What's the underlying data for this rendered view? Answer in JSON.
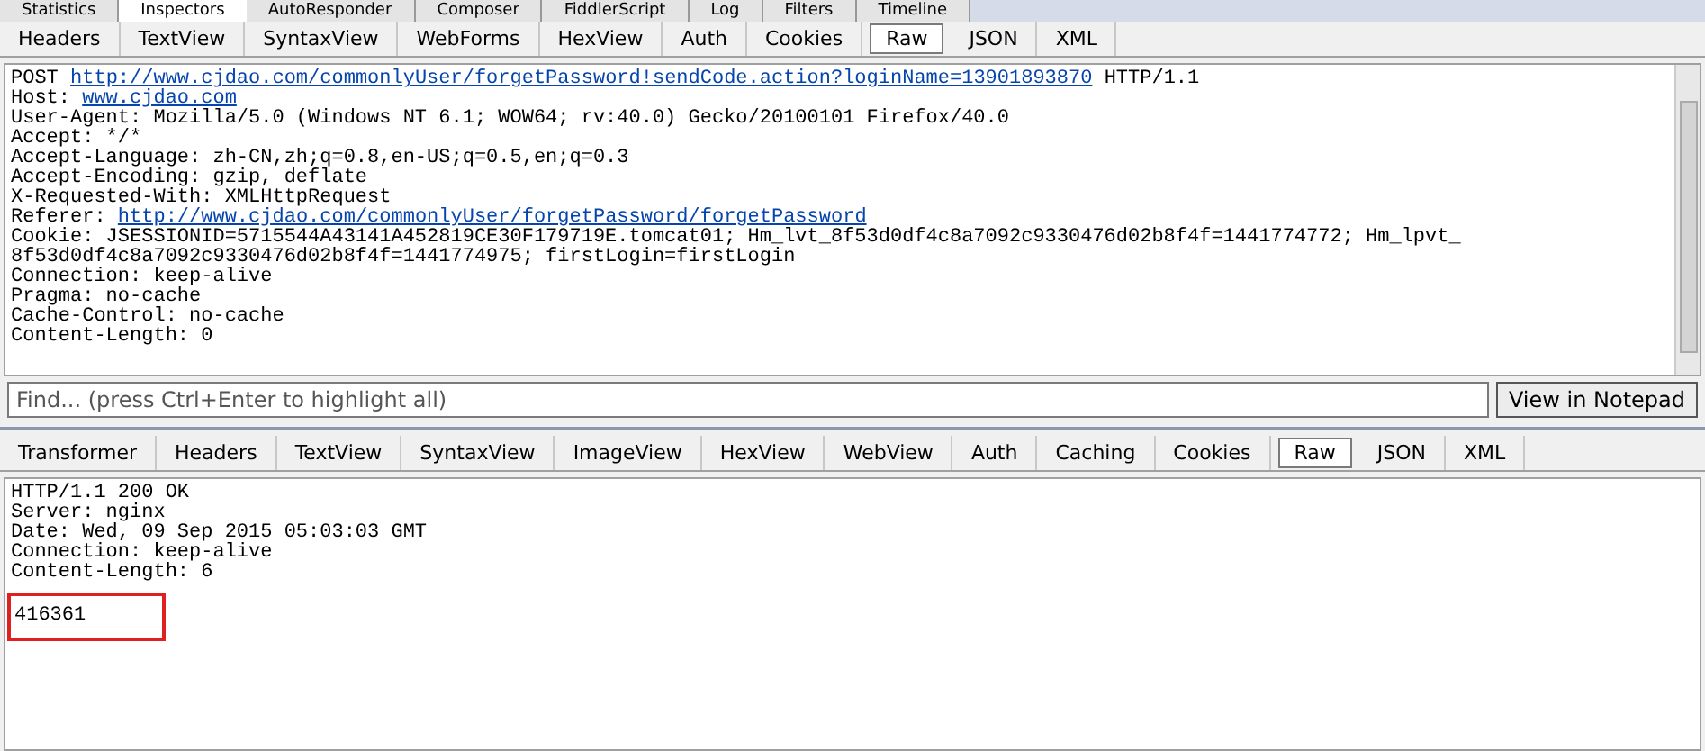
{
  "main_tabs": [
    {
      "label": "Statistics",
      "selected": false
    },
    {
      "label": "Inspectors",
      "selected": true
    },
    {
      "label": "AutoResponder",
      "selected": false
    },
    {
      "label": "Composer",
      "selected": false
    },
    {
      "label": "FiddlerScript",
      "selected": false
    },
    {
      "label": "Log",
      "selected": false
    },
    {
      "label": "Filters",
      "selected": false
    },
    {
      "label": "Timeline",
      "selected": false
    }
  ],
  "request": {
    "tabs": [
      {
        "label": "Headers",
        "selected": false
      },
      {
        "label": "TextView",
        "selected": false
      },
      {
        "label": "SyntaxView",
        "selected": false
      },
      {
        "label": "WebForms",
        "selected": false
      },
      {
        "label": "HexView",
        "selected": false
      },
      {
        "label": "Auth",
        "selected": false
      },
      {
        "label": "Cookies",
        "selected": false
      },
      {
        "label": "Raw",
        "selected": true
      },
      {
        "label": "JSON",
        "selected": false
      },
      {
        "label": "XML",
        "selected": false
      }
    ],
    "lines": [
      {
        "prefix": "POST ",
        "link": "http://www.cjdao.com/commonlyUser/forgetPassword!sendCode.action?loginName=13901893870",
        "suffix": " HTTP/1.1"
      },
      {
        "prefix": "Host: ",
        "link": "www.cjdao.com"
      },
      {
        "prefix": "User-Agent: Mozilla/5.0 (Windows NT 6.1; WOW64; rv:40.0) Gecko/20100101 Firefox/40.0"
      },
      {
        "prefix": "Accept: */*"
      },
      {
        "prefix": "Accept-Language: zh-CN,zh;q=0.8,en-US;q=0.5,en;q=0.3"
      },
      {
        "prefix": "Accept-Encoding: gzip, deflate"
      },
      {
        "prefix": "X-Requested-With: XMLHttpRequest"
      },
      {
        "prefix": "Referer: ",
        "link": "http://www.cjdao.com/commonlyUser/forgetPassword/forgetPassword"
      },
      {
        "prefix": "Cookie: JSESSIONID=5715544A43141A452819CE30F179719E.tomcat01; Hm_lvt_8f53d0df4c8a7092c9330476d02b8f4f=1441774772; Hm_lpvt_"
      },
      {
        "prefix": "8f53d0df4c8a7092c9330476d02b8f4f=1441774975; firstLogin=firstLogin"
      },
      {
        "prefix": "Connection: keep-alive"
      },
      {
        "prefix": "Pragma: no-cache"
      },
      {
        "prefix": "Cache-Control: no-cache"
      },
      {
        "prefix": "Content-Length: 0"
      }
    ],
    "find": {
      "placeholder": "Find... (press Ctrl+Enter to highlight all)"
    },
    "notepad_button": "View in Notepad"
  },
  "response": {
    "tabs": [
      {
        "label": "Transformer",
        "selected": false
      },
      {
        "label": "Headers",
        "selected": false
      },
      {
        "label": "TextView",
        "selected": false
      },
      {
        "label": "SyntaxView",
        "selected": false
      },
      {
        "label": "ImageView",
        "selected": false
      },
      {
        "label": "HexView",
        "selected": false
      },
      {
        "label": "WebView",
        "selected": false
      },
      {
        "label": "Auth",
        "selected": false
      },
      {
        "label": "Caching",
        "selected": false
      },
      {
        "label": "Cookies",
        "selected": false
      },
      {
        "label": "Raw",
        "selected": true
      },
      {
        "label": "JSON",
        "selected": false
      },
      {
        "label": "XML",
        "selected": false
      }
    ],
    "lines": [
      {
        "text": "HTTP/1.1 200 OK",
        "highlighted": false
      },
      {
        "text": "Server: nginx",
        "highlighted": false
      },
      {
        "text": "Date: Wed, 09 Sep 2015 05:03:03 GMT",
        "highlighted": false
      },
      {
        "text": "Connection: keep-alive",
        "highlighted": false
      },
      {
        "text": "Content-Length: 6",
        "highlighted": false
      }
    ],
    "body": {
      "text": "416361",
      "highlighted": true
    }
  }
}
